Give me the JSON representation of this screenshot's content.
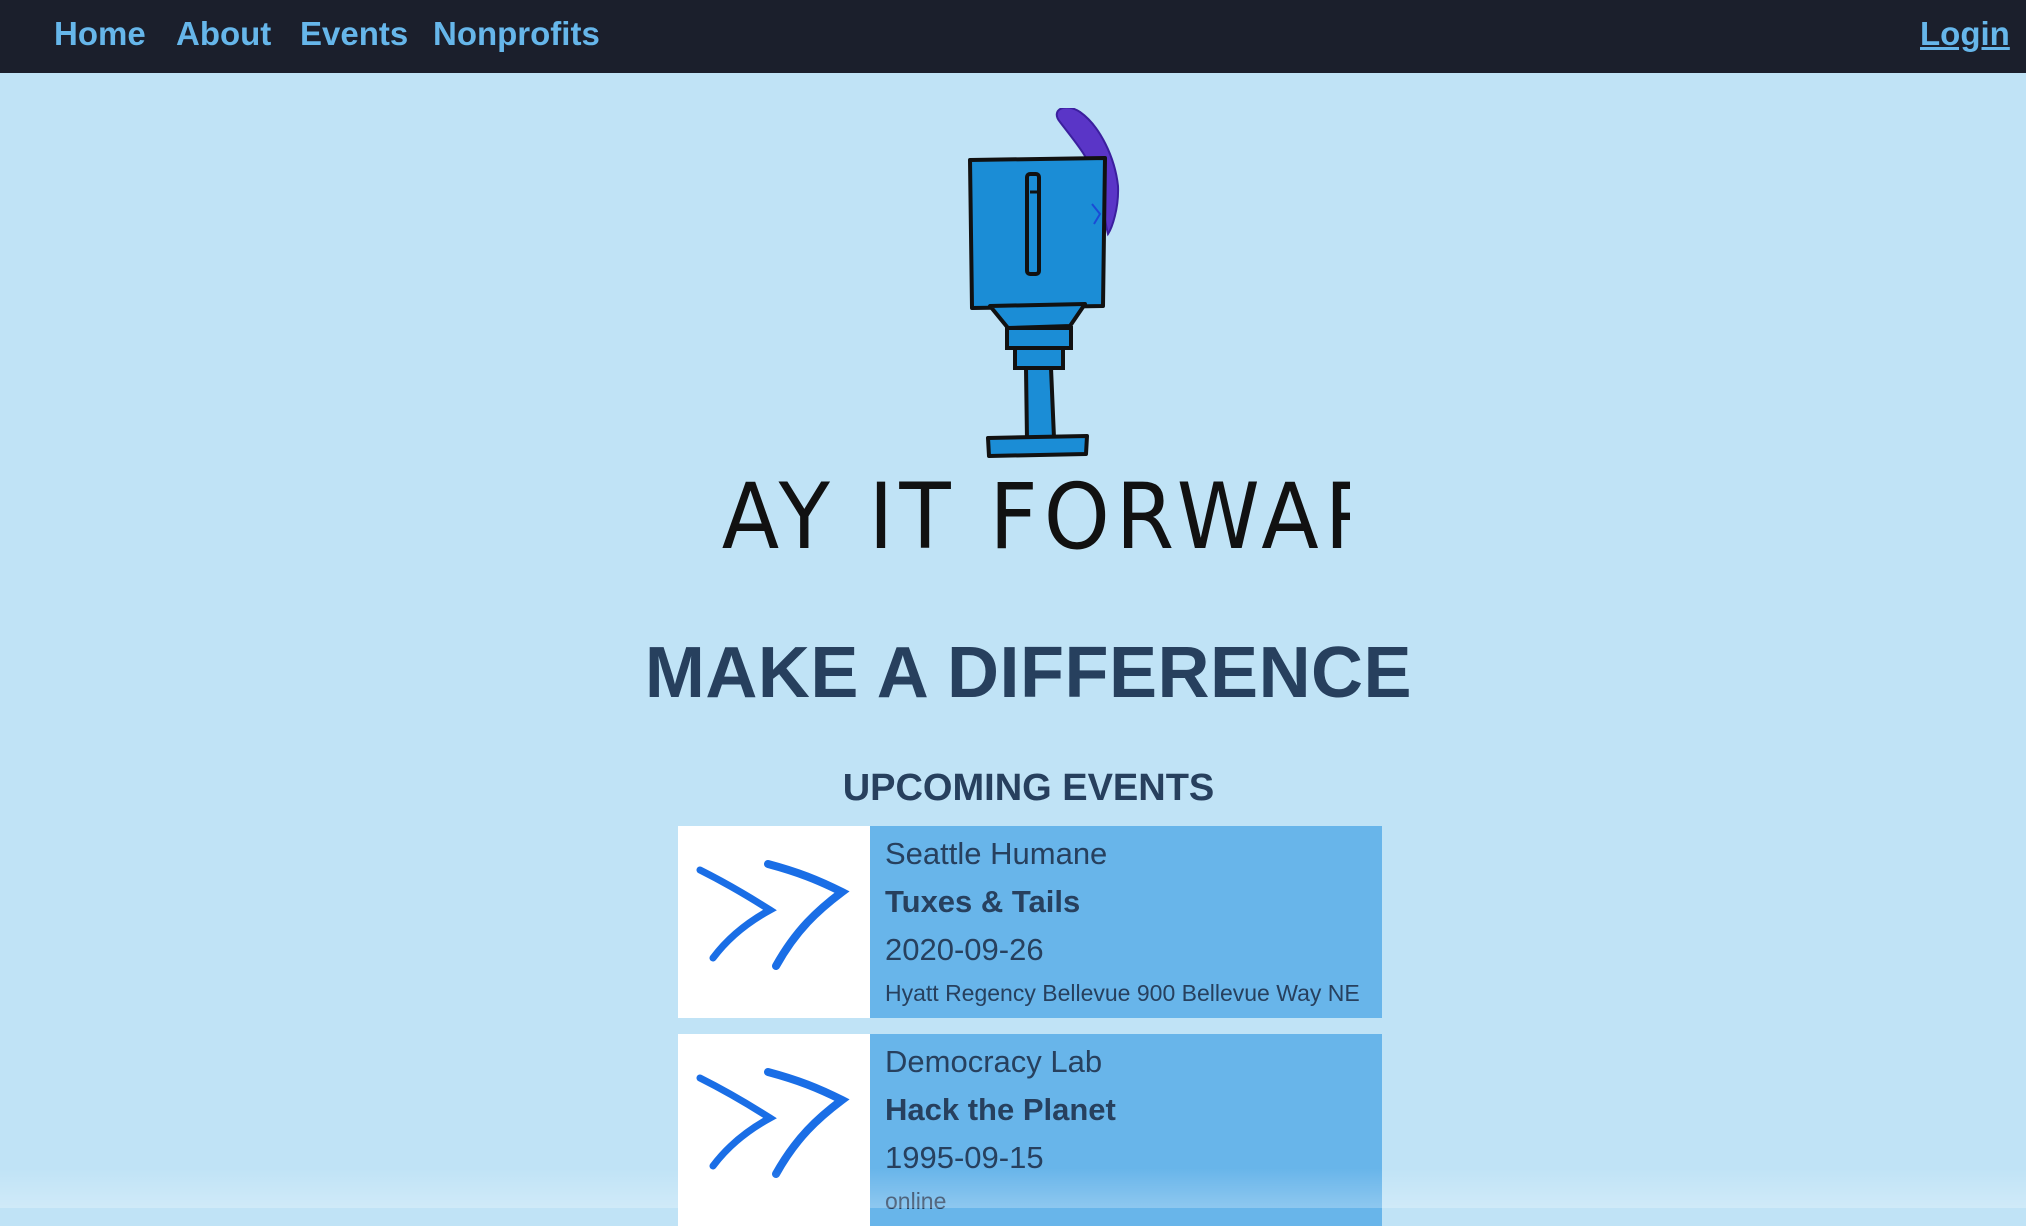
{
  "nav": {
    "home": "Home",
    "about": "About",
    "events": "Events",
    "nonprofits": "Nonprofits",
    "login": "Login"
  },
  "logo": {
    "wordmark": "PLAY IT FORWARD",
    "icon": "trophy-icon"
  },
  "hero": {
    "title": "MAKE A DIFFERENCE"
  },
  "upcoming": {
    "title": "UPCOMING EVENTS",
    "events": [
      {
        "org": "Seattle Humane",
        "name": "Tuxes & Tails",
        "date": "2020-09-26",
        "location": "Hyatt Regency Bellevue 900 Bellevue Way NE"
      },
      {
        "org": "Democracy Lab",
        "name": "Hack the Planet",
        "date": "1995-09-15",
        "location": "online"
      }
    ]
  },
  "colors": {
    "page_bg": "#c0e3f6",
    "nav_bg": "#1b1f2c",
    "nav_link": "#66b6ea",
    "heading": "#27405e",
    "card_bg": "#68b5ea",
    "chevron": "#1a6ee6"
  }
}
